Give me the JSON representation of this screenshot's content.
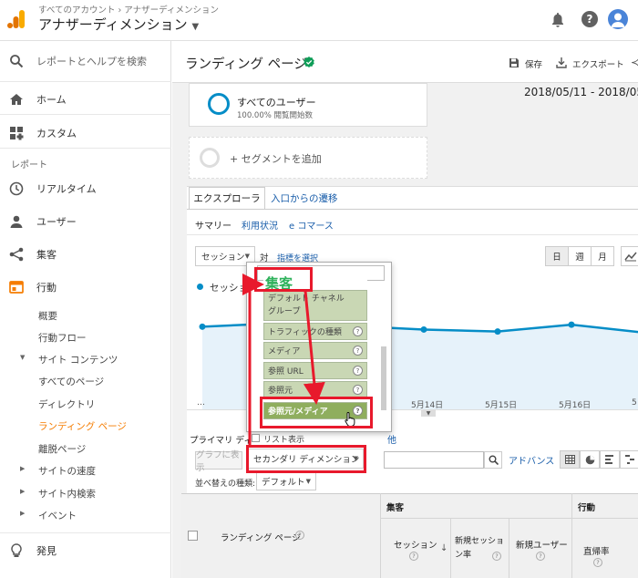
{
  "header": {
    "breadcrumb": "すべてのアカウント › アナザーディメンション",
    "property": "アナザーディメンション"
  },
  "sidebar": {
    "search": "レポートとヘルプを検索",
    "home": "ホーム",
    "custom": "カスタム",
    "section": "レポート",
    "realtime": "リアルタイム",
    "users": "ユーザー",
    "acquisition": "集客",
    "behavior": "行動",
    "sub": {
      "overview": "概要",
      "flow": "行動フロー",
      "site_content": "サイト コンテンツ",
      "all_pages": "すべてのページ",
      "directory": "ディレクトリ",
      "landing": "ランディング ページ",
      "exit": "離脱ページ",
      "speed": "サイトの速度",
      "site_search": "サイト内検索",
      "events": "イベント"
    },
    "discover": "発見"
  },
  "report": {
    "title": "ランディング ページ",
    "save": "保存",
    "export": "エクスポート",
    "date_range": "2018/05/11 - 2018/05/",
    "segment_name": "すべてのユーザー",
    "segment_sub": "100.00% 閲覧開始数",
    "add_segment": "+ セグメントを追加",
    "tab_explorer": "エクスプローラ",
    "tab_entrance": "入口からの遷移",
    "subtab_summary": "サマリー",
    "subtab_usage": "利用状況",
    "subtab_ecommerce": "e コマース",
    "metric_select": "セッション",
    "vs": "対",
    "select_metric": "指標を選択",
    "day": "日",
    "week": "週",
    "month": "月",
    "legend_session": "セッショ",
    "primary_dim": "プライマリ ディ",
    "show_list": "リスト表示",
    "graph_btn": "グラフに表示",
    "secondary_dim": "セカンダリ ディメンション",
    "advance": "アドバンス",
    "sort_label": "並べ替えの種類:",
    "sort_value": "デフォルト"
  },
  "dropdown": {
    "search_value": "",
    "heading": "集客",
    "items": [
      "デフォルト チャネル\nグループ",
      "トラフィックの種類",
      "メディア",
      "参照 URL",
      "参照元",
      "参照元/メディア"
    ]
  },
  "chart_data": {
    "type": "line",
    "series": [
      {
        "values": [
          1000,
          1008,
          1002,
          993,
          988,
          1005,
          985
        ]
      }
    ],
    "x_labels": [
      "…",
      "5月14日",
      "5月15日",
      "5月16日"
    ],
    "color": "#058dc7"
  },
  "table": {
    "group_acq": "集客",
    "group_beh": "行動",
    "col_landing": "ランディング ページ",
    "col_sessions": "セッション",
    "col_new_rate": "新規セッション率",
    "col_new_users": "新規ユーザー",
    "col_bounce": "直帰率"
  },
  "colors": {
    "accent": "#e8192c",
    "ga_blue": "#058dc7",
    "active_nav": "#f57c00"
  }
}
